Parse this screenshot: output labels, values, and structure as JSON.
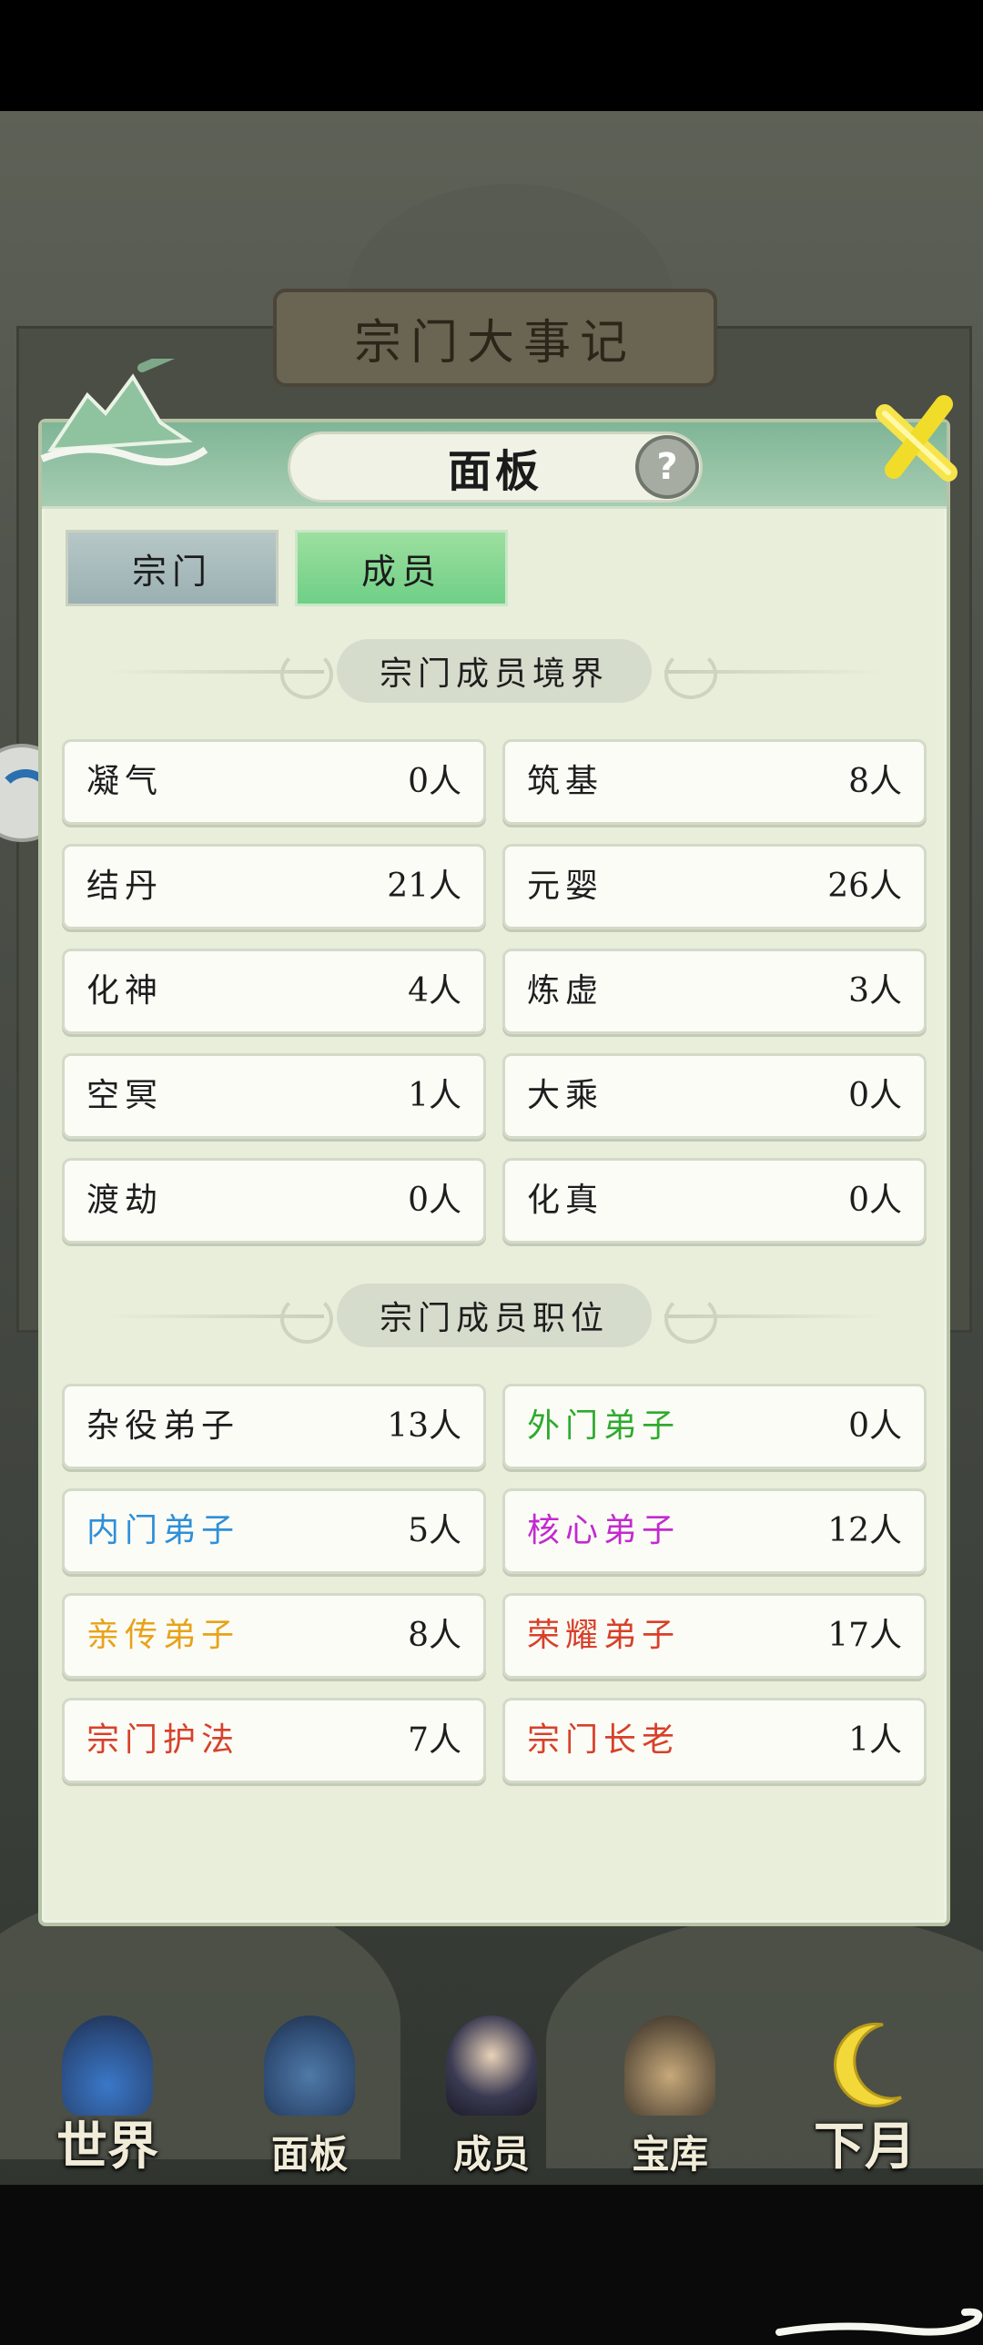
{
  "background": {
    "title": "宗门大事记"
  },
  "dialog": {
    "title": "面板",
    "help_icon": "question-circle-icon",
    "close_icon": "close-x-icon",
    "tabs": [
      {
        "label": "宗门",
        "selected": false
      },
      {
        "label": "成员",
        "selected": true
      }
    ],
    "realm_section": {
      "title": "宗门成员境界",
      "items": [
        {
          "name": "凝气",
          "count": "0人"
        },
        {
          "name": "筑基",
          "count": "8人"
        },
        {
          "name": "结丹",
          "count": "21人"
        },
        {
          "name": "元婴",
          "count": "26人"
        },
        {
          "name": "化神",
          "count": "4人"
        },
        {
          "name": "炼虚",
          "count": "3人"
        },
        {
          "name": "空冥",
          "count": "1人"
        },
        {
          "name": "大乘",
          "count": "0人"
        },
        {
          "name": "渡劫",
          "count": "0人"
        },
        {
          "name": "化真",
          "count": "0人"
        }
      ]
    },
    "position_section": {
      "title": "宗门成员职位",
      "items": [
        {
          "name": "杂役弟子",
          "count": "13人",
          "color": "#1d1d1d"
        },
        {
          "name": "外门弟子",
          "count": "0人",
          "color": "#2faa2f"
        },
        {
          "name": "内门弟子",
          "count": "5人",
          "color": "#2f8fd8"
        },
        {
          "name": "核心弟子",
          "count": "12人",
          "color": "#c22ad0"
        },
        {
          "name": "亲传弟子",
          "count": "8人",
          "color": "#e8a21a"
        },
        {
          "name": "荣耀弟子",
          "count": "17人",
          "color": "#d8402a"
        },
        {
          "name": "宗门护法",
          "count": "7人",
          "color": "#d8402a"
        },
        {
          "name": "宗门长老",
          "count": "1人",
          "color": "#d8402a"
        }
      ]
    }
  },
  "bottom_nav": [
    {
      "label": "世界",
      "icon": "world-palace-icon"
    },
    {
      "label": "面板",
      "icon": "panel-gate-icon"
    },
    {
      "label": "成员",
      "icon": "member-portrait-icon"
    },
    {
      "label": "宝库",
      "icon": "treasury-tower-icon"
    },
    {
      "label": "下月",
      "icon": "crescent-moon-icon"
    }
  ]
}
